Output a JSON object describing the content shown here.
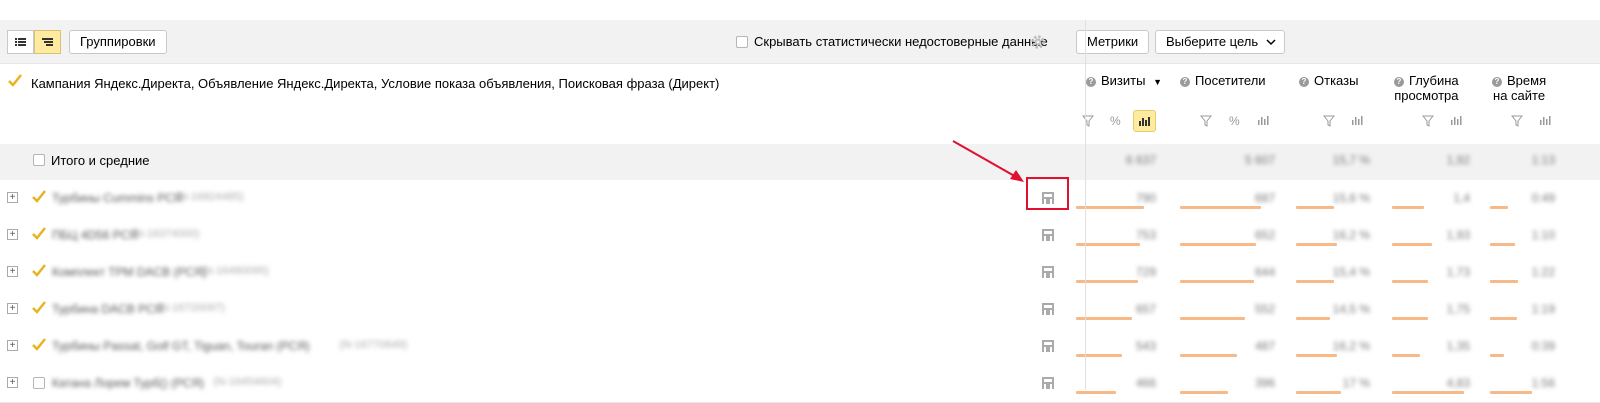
{
  "toolbar": {
    "groupings_label": "Группировки",
    "hide_unreliable_label": "Скрывать статистически недостоверные данные",
    "metrics_label": "Метрики",
    "goal_label": "Выберите цель"
  },
  "grouping_header": {
    "label": "Кампания Яндекс.Директа, Объявление Яндекс.Директа, Условие показа объявления, Поисковая фраза (Директ)"
  },
  "columns": [
    {
      "title_line1": "Визиты",
      "title_line2": "",
      "sorted": "▼"
    },
    {
      "title_line1": "Посетители",
      "title_line2": ""
    },
    {
      "title_line1": "Отказы",
      "title_line2": ""
    },
    {
      "title_line1": "Глубина",
      "title_line2": "просмотра"
    },
    {
      "title_line1": "Время",
      "title_line2": "на сайте"
    }
  ],
  "totals": {
    "label": "Итого и средние",
    "values": [
      "6 637",
      "5 607",
      "15,7 %",
      "1,92",
      "1:13"
    ]
  },
  "rows": [
    {
      "name": "Турбины Cummins РСЯ",
      "id": "(N-16824485)",
      "values": [
        "790",
        "687",
        "15,6 %",
        "1,4",
        "0:49"
      ],
      "bars": [
        0.85,
        0.85,
        0.5,
        0.4,
        0.25
      ]
    },
    {
      "name": "ПБЦ 4D56 РСЯ",
      "id": "(N-16374000)",
      "values": [
        "753",
        "652",
        "16,2 %",
        "1,93",
        "1:10"
      ],
      "bars": [
        0.8,
        0.8,
        0.55,
        0.5,
        0.35
      ]
    },
    {
      "name": "Комплект ТРМ DACB (РСЯ)",
      "id": "(N-16480095)",
      "values": [
        "729",
        "644",
        "15,4 %",
        "1,73",
        "1:22"
      ],
      "bars": [
        0.78,
        0.78,
        0.5,
        0.45,
        0.4
      ]
    },
    {
      "name": "Турбина DACB РСЯ",
      "id": "(N-16720097)",
      "values": [
        "657",
        "552",
        "14,5 %",
        "1,75",
        "1:19"
      ],
      "bars": [
        0.7,
        0.68,
        0.45,
        0.45,
        0.38
      ]
    },
    {
      "name": "Турбины Passat, Golf GT, Tiguan, Touran (РСЯ)",
      "id": "(N-16770649)",
      "values": [
        "543",
        "487",
        "16,2 %",
        "1,35",
        "0:39"
      ],
      "bars": [
        0.58,
        0.6,
        0.55,
        0.35,
        0.2
      ]
    },
    {
      "name": "Катана Лорем Турб() (РСЯ)",
      "id": "(N-16454604)",
      "values": [
        "466",
        "396",
        "17 %",
        "4,83",
        "1:56"
      ],
      "bars": [
        0.5,
        0.5,
        0.6,
        0.9,
        0.6
      ]
    }
  ],
  "colors": {
    "accent_yellow": "#ffeba0",
    "check_yellow": "#e6b422",
    "bar_orange": "#f7b987",
    "highlight_red": "#e0102f"
  }
}
